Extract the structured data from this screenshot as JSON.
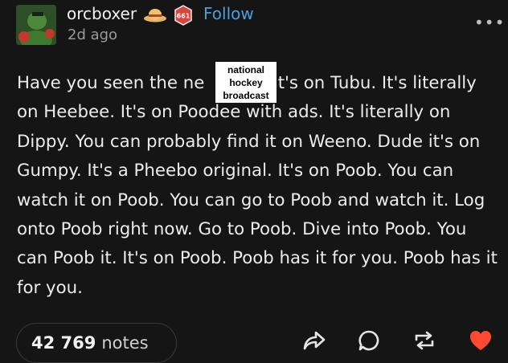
{
  "post": {
    "author": "orcboxer",
    "badge_text": "661",
    "follow_label": "Follow",
    "timestamp": "2d ago",
    "more_label": "•••",
    "text_before": "Have you seen the ne",
    "text_after": "? It's on Tubu. It's literally on Heebee. It's on Poodee with ads. It's literally on Dippy. You can probably find it on Weeno. Dude it's on Gumpy. It's a Pheebo original. It's on Poob. You can watch it on Poob. You can go to Poob and watch it. Log onto Poob right now. Go to Poob. Dive into Poob. You can Poob it. It's on Poob. Poob has it for you. Poob has it for you.",
    "sticker": {
      "line1": "national",
      "line2": "hockey",
      "line3": "broadcast"
    }
  },
  "footer": {
    "notes_count": "42 769",
    "notes_label": "notes"
  },
  "icons": {
    "hat": "straw-hat-icon",
    "badge": "badge-icon",
    "share": "share-icon",
    "reply": "reply-icon",
    "reblog": "reblog-icon",
    "like": "heart-icon"
  },
  "colors": {
    "background": "#151515",
    "follow": "#4b9fe0",
    "heart": "#ff4930",
    "badge": "#d8453c"
  }
}
